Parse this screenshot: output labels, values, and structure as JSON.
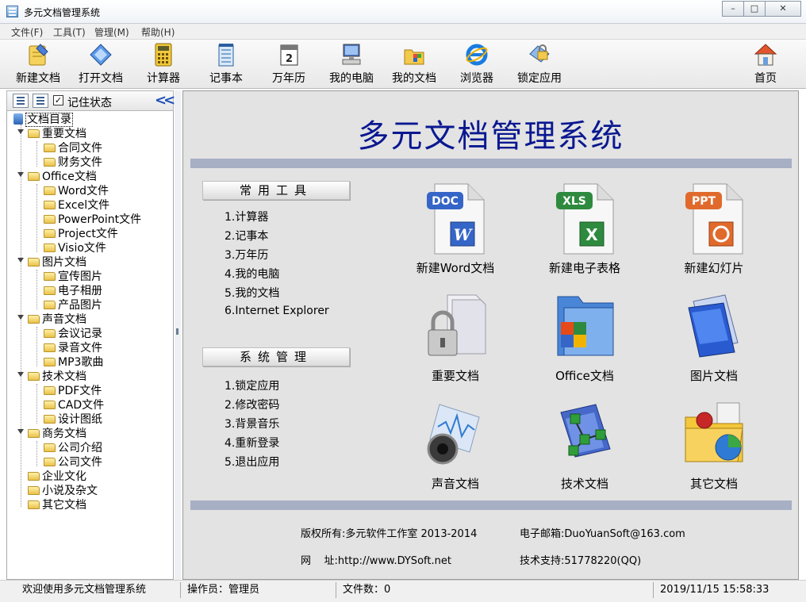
{
  "window": {
    "title": "多元文档管理系统"
  },
  "menu": [
    "文件(F)",
    "工具(T)",
    "管理(M)",
    "帮助(H)"
  ],
  "toolbar": {
    "new_doc": "新建文档",
    "open_doc": "打开文档",
    "calculator": "计算器",
    "notepad": "记事本",
    "calendar": "万年历",
    "my_computer": "我的电脑",
    "my_documents": "我的文档",
    "browser": "浏览器",
    "lock_app": "锁定应用",
    "home": "首页"
  },
  "tree_header": {
    "remember_state": "记住状态"
  },
  "tree": {
    "root": "文档目录",
    "important": "重要文档",
    "contract": "合同文件",
    "finance": "财务文件",
    "office": "Office文档",
    "word": "Word文件",
    "excel": "Excel文件",
    "powerpoint": "PowerPoint文件",
    "project": "Project文件",
    "visio": "Visio文件",
    "pictures": "图片文档",
    "promo": "宣传图片",
    "album": "电子相册",
    "product": "产品图片",
    "audio": "声音文档",
    "meeting": "会议记录",
    "recording": "录音文件",
    "mp3": "MP3歌曲",
    "tech": "技术文档",
    "pdf": "PDF文件",
    "cad": "CAD文件",
    "drawings": "设计图纸",
    "business": "商务文档",
    "company_intro": "公司介绍",
    "company_files": "公司文件",
    "culture": "企业文化",
    "novels": "小说及杂文",
    "other": "其它文档"
  },
  "main": {
    "title": "多元文档管理系统",
    "tools_header": "常用工具",
    "tools": [
      "1.计算器",
      "2.记事本",
      "3.万年历",
      "4.我的电脑",
      "5.我的文档",
      "6.Internet Explorer"
    ],
    "admin_header": "系统管理",
    "admin": [
      "1.锁定应用",
      "2.修改密码",
      "3.背景音乐",
      "4.重新登录",
      "5.退出应用"
    ],
    "tiles": {
      "new_word": "新建Word文档",
      "new_excel": "新建电子表格",
      "new_ppt": "新建幻灯片",
      "important_docs": "重要文档",
      "office_docs": "Office文档",
      "picture_docs": "图片文档",
      "audio_docs": "声音文档",
      "tech_docs": "技术文档",
      "other_docs": "其它文档"
    },
    "doc_badges": {
      "doc": "DOC",
      "xls": "XLS",
      "ppt": "PPT"
    },
    "footer": {
      "copyright": "版权所有:多元软件工作室 2013-2014",
      "email": "电子邮箱:DuoYuanSoft@163.com",
      "website": "网    址:http://www.DYSoft.net",
      "support": "技术支持:51778220(QQ)"
    }
  },
  "status": {
    "welcome": "欢迎使用多元文档管理系统",
    "operator": "操作员：管理员",
    "file_count": "文件数：0",
    "datetime": "2019/11/15 15:58:33"
  },
  "colors": {
    "title_blue": "#0a1890",
    "bar": "#a6afc4",
    "main_bg": "#e3e3e3"
  }
}
